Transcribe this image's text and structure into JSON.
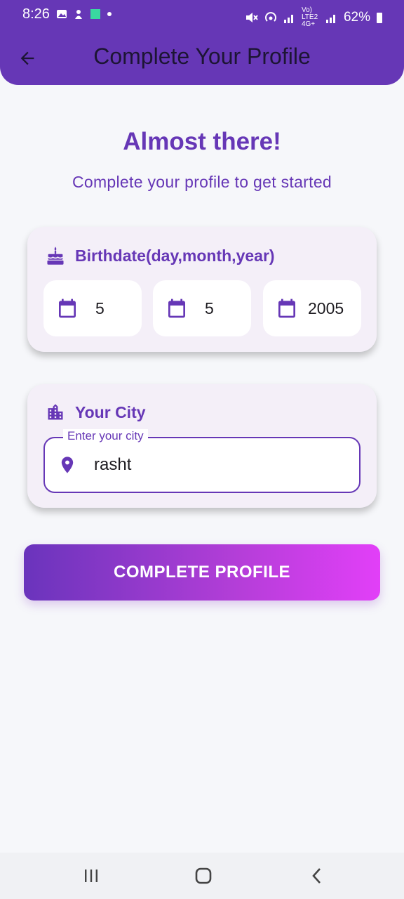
{
  "status_bar": {
    "time": "8:26",
    "battery": "62%",
    "network_label": "Vo) LTE2 4G+"
  },
  "app_bar": {
    "title": "Complete Your Profile",
    "back_icon": "arrow-back-icon"
  },
  "header": {
    "heading": "Almost there!",
    "subheading": "Complete your profile to get started"
  },
  "birthdate": {
    "title": "Birthdate(day,month,year)",
    "icon": "cake-icon",
    "day": "5",
    "month": "5",
    "year": "2005",
    "field_icon": "calendar-icon"
  },
  "city": {
    "title": "Your City",
    "icon": "city-icon",
    "field_label": "Enter your city",
    "value": "rasht",
    "field_icon": "location-pin-icon"
  },
  "submit": {
    "label": "COMPLETE PROFILE"
  },
  "colors": {
    "primary": "#6637b6",
    "gradient_end": "#e23ff8",
    "card_bg": "#f4eff8",
    "page_bg": "#f6f7fa"
  }
}
